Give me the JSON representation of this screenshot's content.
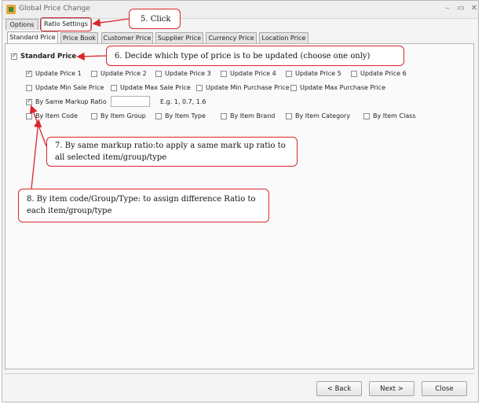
{
  "window": {
    "title": "Global Price Change",
    "min": "–",
    "max": "▭",
    "close": "✕"
  },
  "top_tabs": [
    {
      "label": "Options"
    },
    {
      "label": "Ratio Settings"
    }
  ],
  "inner_tabs": [
    {
      "label": "Standard Price"
    },
    {
      "label": "Price Book"
    },
    {
      "label": "Customer Price"
    },
    {
      "label": "Supplier Price"
    },
    {
      "label": "Currency Price"
    },
    {
      "label": "Location Price"
    }
  ],
  "standard_price": {
    "label": "Standard Price",
    "checked": true
  },
  "price_options": [
    {
      "label": "Update Price 1",
      "checked": true
    },
    {
      "label": "Update Price 2",
      "checked": false
    },
    {
      "label": "Update Price 3",
      "checked": false
    },
    {
      "label": "Update Price 4",
      "checked": false
    },
    {
      "label": "Update Price 5",
      "checked": false
    },
    {
      "label": "Update Price 6",
      "checked": false
    }
  ],
  "minmax_options": [
    {
      "label": "Update Min Sale Price",
      "checked": false
    },
    {
      "label": "Update Max Sale Price",
      "checked": false
    },
    {
      "label": "Update Min Purchase Price",
      "checked": false
    },
    {
      "label": "Update Max Purchase Price",
      "checked": false
    }
  ],
  "markup": {
    "label": "By Same Markup Ratio",
    "checked": true,
    "value": "",
    "hint": "E.g. 1, 0.7, 1.6"
  },
  "by_options": [
    {
      "label": "By Item Code",
      "checked": false
    },
    {
      "label": "By Item Group",
      "checked": false
    },
    {
      "label": "By Item Type",
      "checked": false
    },
    {
      "label": "By Item Brand",
      "checked": false
    },
    {
      "label": "By Item Category",
      "checked": false
    },
    {
      "label": "By Item Class",
      "checked": false
    }
  ],
  "callouts": {
    "c5": "5. Click",
    "c6": "6. Decide which type of price is to be updated (choose one only)",
    "c7": "7. By same markup ratio:to apply a same mark up ratio to all selected item/group/type",
    "c8": "8. By item code/Group/Type:  to assign difference Ratio to each item/group/type"
  },
  "footer": {
    "back": "< Back",
    "next": "Next >",
    "close": "Close"
  },
  "colors": {
    "callout_border": "#d9262b"
  }
}
